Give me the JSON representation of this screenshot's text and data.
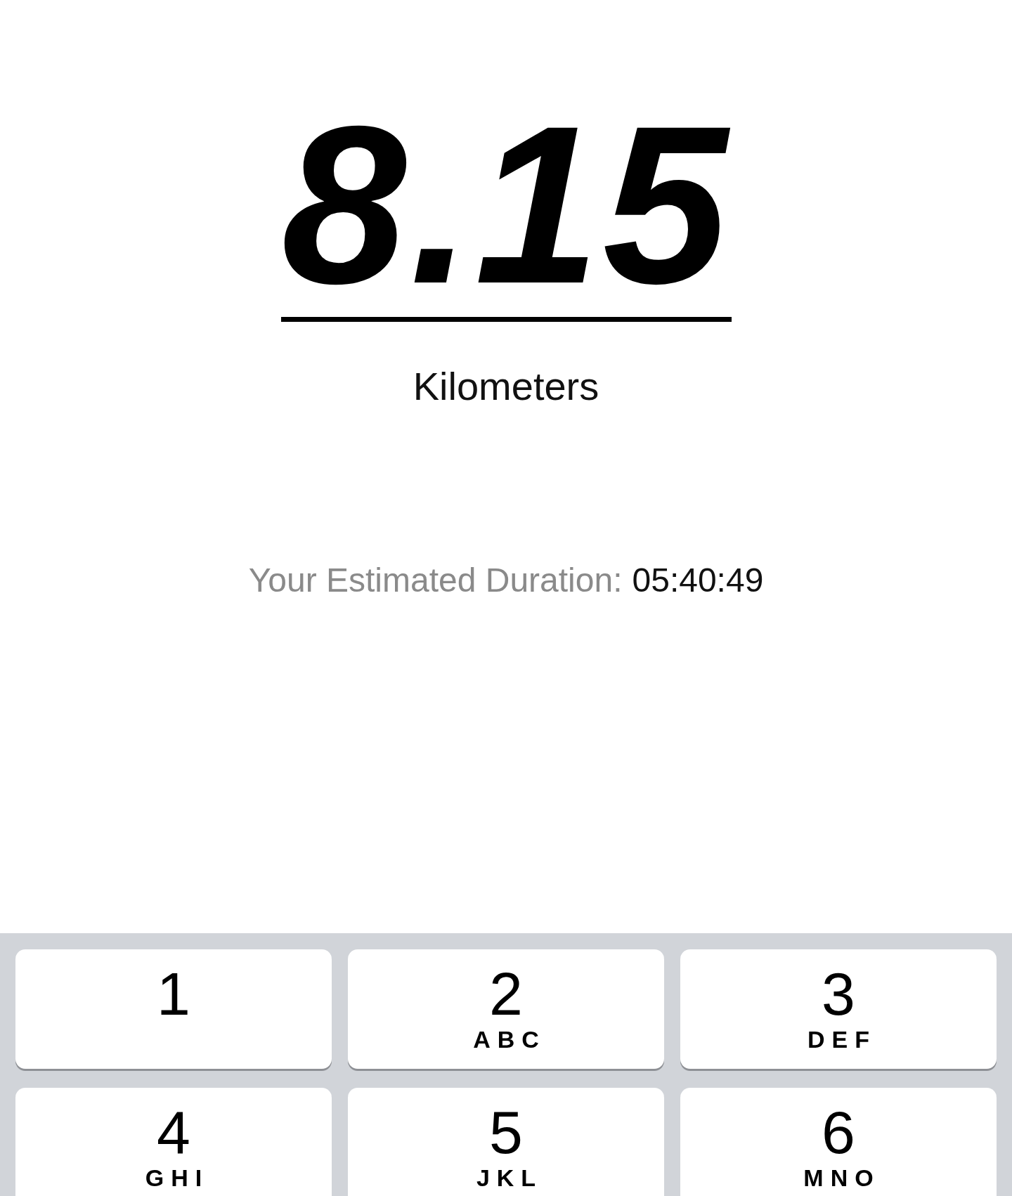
{
  "distance": {
    "value": "8.15",
    "unit": "Kilometers"
  },
  "duration": {
    "label": "Your Estimated Duration:",
    "value": "05:40:49"
  },
  "keypad": {
    "keys": [
      {
        "digit": "1"
      },
      {
        "digit": "2",
        "letters": "ABC"
      },
      {
        "digit": "3",
        "letters": "DEF"
      },
      {
        "digit": "4",
        "letters": "GHI"
      },
      {
        "digit": "5",
        "letters": "JKL"
      },
      {
        "digit": "6",
        "letters": "MNO"
      }
    ]
  }
}
